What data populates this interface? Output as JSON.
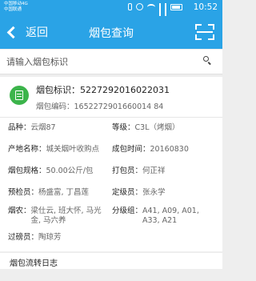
{
  "status_bar": {
    "carrier_1": "中国移动4G",
    "carrier_2": "中国联通",
    "time": "10:52"
  },
  "header": {
    "back_label": "返回",
    "title": "烟包查询"
  },
  "search": {
    "placeholder": "请输入烟包标识"
  },
  "bale": {
    "id_label": "烟包标识：",
    "id_value": "5227292016022031",
    "code_label": "烟包编码：",
    "code_value": "1652272901660014 84"
  },
  "fields": {
    "variety_label": "品种：",
    "variety_value": "云烟87",
    "grade_label": "等级：",
    "grade_value": "C3L（烤烟）",
    "origin_label": "产地名称：",
    "origin_value": "城关烟叶收购点",
    "pack_time_label": "成包时间：",
    "pack_time_value": "20160830",
    "spec_label": "烟包规格：",
    "spec_value": "50.00公斤/包",
    "packer_label": "打包员：",
    "packer_value": "何正祥",
    "pregrader_label": "预检员：",
    "pregrader_value": "杨盛富, 丁昌莲",
    "grader_label": "定级员：",
    "grader_value": "张永学",
    "farmer_label": "烟农：",
    "farmer_value": "梁仕云, 班大怀, 马光金, 马六养",
    "class_label": "分级组：",
    "class_value": "A41, A09, A01, A33, A21",
    "weigher_label": "过磅员：",
    "weigher_value": "陶琼芳"
  },
  "footer": {
    "log_label": "烟包流转日志"
  }
}
